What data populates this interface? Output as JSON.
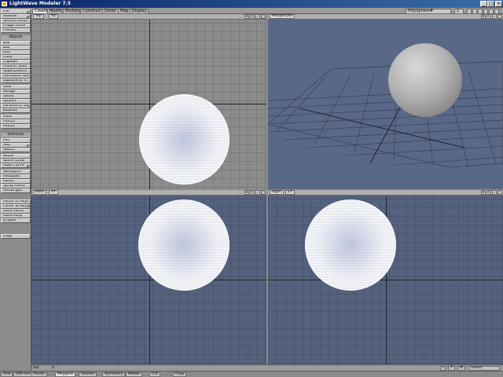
{
  "window": {
    "title": "LightWave Modeler 7.5"
  },
  "tabs": [
    "Create",
    "Modify",
    "Multiply",
    "Construct",
    "Detail",
    "Map",
    "Display"
  ],
  "active_tab": "Create",
  "top_right": {
    "object": "PolySphere#",
    "layer_dropdown": "1"
  },
  "left_panel": {
    "top_buttons": [
      "File",
      "Modeler",
      "Surface Editor",
      "Image Editor",
      "Presets"
    ],
    "objects_header": "Objects",
    "objects": [
      "Box",
      "Ball",
      "Disc",
      "Cone",
      "Capsule",
      "Platonic Solid",
      "SuperQuadric",
      "Gemstone Tool",
      "Equilateral Tri",
      "Gear",
      "Wedge",
      "Toroid",
      "Quadric",
      "Parametric Obj",
      "Bubbles",
      "Helix",
      "Plot1D",
      "Plot2D"
    ],
    "elements_header": "Elements",
    "elements": [
      "Pen",
      "Text",
      "Sketch",
      "Bezier",
      "Spline Draw",
      "Make Curve",
      "Skelegons",
      "Metaballs",
      "Points",
      "Spray Points",
      "Metaedges"
    ],
    "other": [
      "Points to Polys",
      "Curve To Polygon",
      "Rand Points",
      "Rand Polys",
      "Dripple"
    ],
    "copy": "Copy"
  },
  "viewports": {
    "top": {
      "label": "Top",
      "mode": "XZ"
    },
    "perspective": {
      "label": "Perspective"
    },
    "back": {
      "label": "Back",
      "mode": "XY"
    },
    "right": {
      "label": "Right",
      "mode": "ZY"
    }
  },
  "bottom": {
    "sel_label": "Sel:",
    "sel_value": "0",
    "right_controls": [
      "T",
      "M"
    ],
    "layer_label": "(none)",
    "grid_label": "Grid",
    "grid_value": "200 mm",
    "modes": [
      "Points",
      "Polygons",
      "Volume",
      "Symmetry",
      "Modes",
      "Cut",
      "Copy"
    ],
    "active_mode": "Polygons"
  }
}
